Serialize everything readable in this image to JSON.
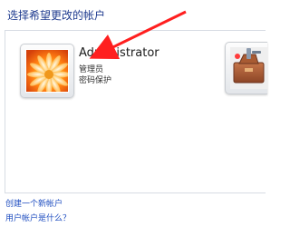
{
  "page_title": "选择希望更改的帐户",
  "accounts": [
    {
      "name": "Administrator",
      "role": "管理员",
      "password": "密码保护",
      "avatar_icon": "flower-icon"
    },
    {
      "avatar_icon": "toolbox-icon"
    }
  ],
  "links": {
    "create_account": "创建一个新帐户",
    "what_is_account": "用户帐户是什么？"
  },
  "colors": {
    "title": "#1f3b8f",
    "link": "#1f4ec0",
    "arrow": "#ff1f1f"
  }
}
